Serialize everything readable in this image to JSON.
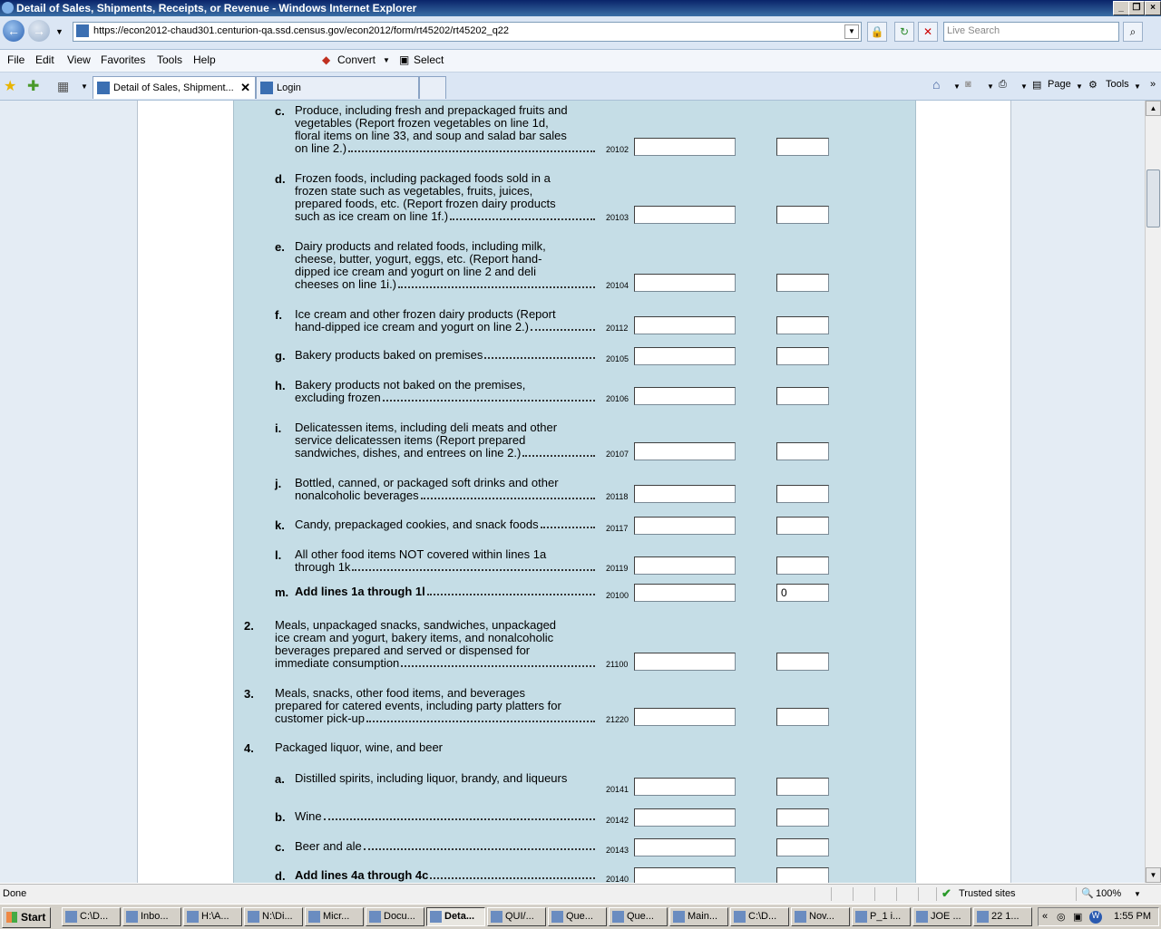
{
  "window": {
    "title": "Detail of Sales, Shipments, Receipts, or Revenue - Windows Internet Explorer"
  },
  "address": {
    "url": "https://econ2012-chaud301.centurion-qa.ssd.census.gov/econ2012/form/rt45202/rt45202_q22",
    "search_placeholder": "Live Search"
  },
  "menu": {
    "file": "File",
    "edit": "Edit",
    "view": "View",
    "favorites": "Favorites",
    "tools": "Tools",
    "help": "Help",
    "convert": "Convert",
    "select": "Select"
  },
  "tabs": [
    {
      "label": "Detail of Sales, Shipment..."
    },
    {
      "label": "Login"
    }
  ],
  "command_bar": {
    "page": "Page",
    "tools": "Tools"
  },
  "form": {
    "rows": [
      {
        "label": "c.",
        "lines": [
          "Produce, including fresh and prepackaged fruits and",
          "vegetables (Report frozen vegetables on line 1d,",
          "floral items on line 33, and soup and salad bar sales"
        ],
        "last": "on line 2.)",
        "code": "20102",
        "value": ""
      },
      {
        "label": "d.",
        "lines": [
          "Frozen foods, including packaged foods sold in a",
          "frozen state such as vegetables, fruits, juices,",
          "prepared foods, etc. (Report frozen dairy products"
        ],
        "last": "such as ice cream on line 1f.)",
        "code": "20103",
        "value": ""
      },
      {
        "label": "e.",
        "lines": [
          "Dairy products and related foods, including milk,",
          "cheese, butter, yogurt, eggs, etc. (Report hand-",
          "dipped ice cream and yogurt on line 2 and deli"
        ],
        "last": "cheeses on line 1i.)",
        "code": "20104",
        "value": ""
      },
      {
        "label": "f.",
        "lines": [
          "Ice cream and other frozen dairy products (Report"
        ],
        "last": "hand-dipped ice cream and yogurt on line 2.)",
        "code": "20112",
        "value": ""
      },
      {
        "label": "g.",
        "lines": [],
        "last": "Bakery products baked on premises",
        "code": "20105",
        "value": ""
      },
      {
        "label": "h.",
        "lines": [
          "Bakery products not baked on the premises,"
        ],
        "last": "excluding frozen",
        "code": "20106",
        "value": ""
      },
      {
        "label": "i.",
        "lines": [
          "Delicatessen items, including deli meats and other",
          "service delicatessen items (Report prepared"
        ],
        "last": "sandwiches, dishes, and entrees on line 2.)",
        "code": "20107",
        "value": ""
      },
      {
        "label": "j.",
        "lines": [
          "Bottled, canned, or packaged soft drinks and other"
        ],
        "last": "nonalcoholic beverages",
        "code": "20118",
        "value": ""
      },
      {
        "label": "k.",
        "lines": [],
        "last": "Candy, prepackaged cookies, and snack foods",
        "code": "20117",
        "value": ""
      },
      {
        "label": "l.",
        "lines": [
          "All other food items NOT covered within lines 1a"
        ],
        "last": "through 1k",
        "code": "20119",
        "value": ""
      },
      {
        "label": "m.",
        "lines": [],
        "last": "Add lines 1a through 1l",
        "code": "20100",
        "value": "0"
      },
      {
        "label": "2.",
        "lines": [
          "Meals, unpackaged snacks, sandwiches, unpackaged",
          "ice cream and yogurt, bakery items, and nonalcoholic",
          "beverages prepared and served or dispensed for"
        ],
        "last": "immediate consumption",
        "code": "21100",
        "value": ""
      },
      {
        "label": "3.",
        "lines": [
          "Meals, snacks, other food items, and beverages",
          "prepared for catered events, including party platters for"
        ],
        "last": "customer pick-up",
        "code": "21220",
        "value": ""
      },
      {
        "label": "4.",
        "heading": "Packaged liquor, wine, and beer"
      },
      {
        "label": "a.",
        "lines": [],
        "plain": "Distilled spirits, including liquor, brandy, and liqueurs",
        "code": "20141",
        "value": ""
      },
      {
        "label": "b.",
        "lines": [],
        "last": "Wine",
        "code": "20142",
        "value": ""
      },
      {
        "label": "c.",
        "lines": [],
        "last": "Beer and ale",
        "code": "20143",
        "value": ""
      },
      {
        "label": "d.",
        "lines": [],
        "last": "Add lines 4a through 4c",
        "code": "20140",
        "value": ""
      }
    ]
  },
  "status": {
    "text": "Done",
    "zone": "Trusted sites",
    "zoom": "100%"
  },
  "taskbar": {
    "start": "Start",
    "items": [
      "C:\\D...",
      "Inbo...",
      "H:\\A...",
      "N:\\Di...",
      "Micr...",
      "Docu...",
      "Deta...",
      "QUI/...",
      "Que...",
      "Que...",
      "Main...",
      "C:\\D...",
      "Nov...",
      "P_1 i...",
      "JOE ...",
      "22 1..."
    ],
    "clock": "1:55 PM"
  }
}
